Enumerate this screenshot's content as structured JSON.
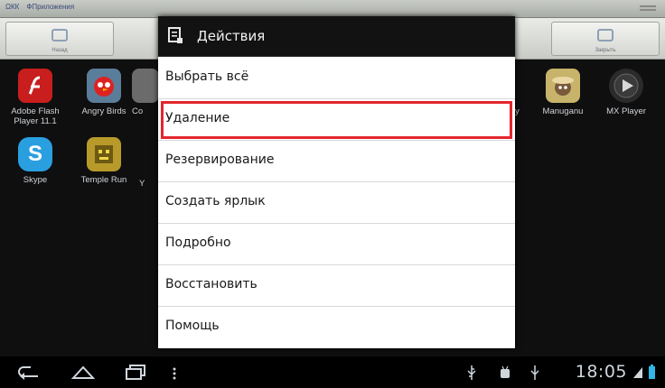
{
  "browser": {
    "tabs": [
      "ΩКК",
      "ФПриложения"
    ]
  },
  "toolbar": {
    "left_label": "Назад",
    "right_label": "Закрыть"
  },
  "apps_left": [
    {
      "label": "Adobe Flash\nPlayer 11.1",
      "icon": "flash-icon",
      "color": "#c81e1e",
      "glyph": "f"
    },
    {
      "label": "Angry Birds",
      "icon": "angry-birds-icon",
      "color": "#5a7d9a",
      "glyph": "●"
    },
    {
      "label": "Co",
      "icon": "partial-app-icon",
      "color": "#888888",
      "glyph": ""
    },
    {
      "label": "Skype",
      "icon": "skype-icon",
      "color": "#2a9fe0",
      "glyph": "S"
    },
    {
      "label": "Temple Run",
      "icon": "temple-run-icon",
      "color": "#b89a2b",
      "glyph": "☻"
    },
    {
      "label": "Y",
      "icon": "partial-app-icon-2",
      "color": "#777777",
      "glyph": ""
    }
  ],
  "apps_right": [
    {
      "label": "y",
      "icon": "partial-app-icon-3",
      "color": "#555555",
      "glyph": ""
    },
    {
      "label": "Manuganu",
      "icon": "manuganu-icon",
      "color": "#c7b36a",
      "glyph": "☻"
    },
    {
      "label": "MX Player",
      "icon": "mx-player-icon",
      "color": "#2b2b2b",
      "glyph": "▶"
    }
  ],
  "dialog": {
    "title": "Действия",
    "items": [
      "Выбрать всё",
      "Удаление",
      "Резервирование",
      "Создать ярлык",
      "Подробно",
      "Восстановить",
      "Помощь"
    ],
    "highlighted_item": "Удаление",
    "highlight_color": "#e3262d"
  },
  "statusbar": {
    "time": "18:05"
  }
}
